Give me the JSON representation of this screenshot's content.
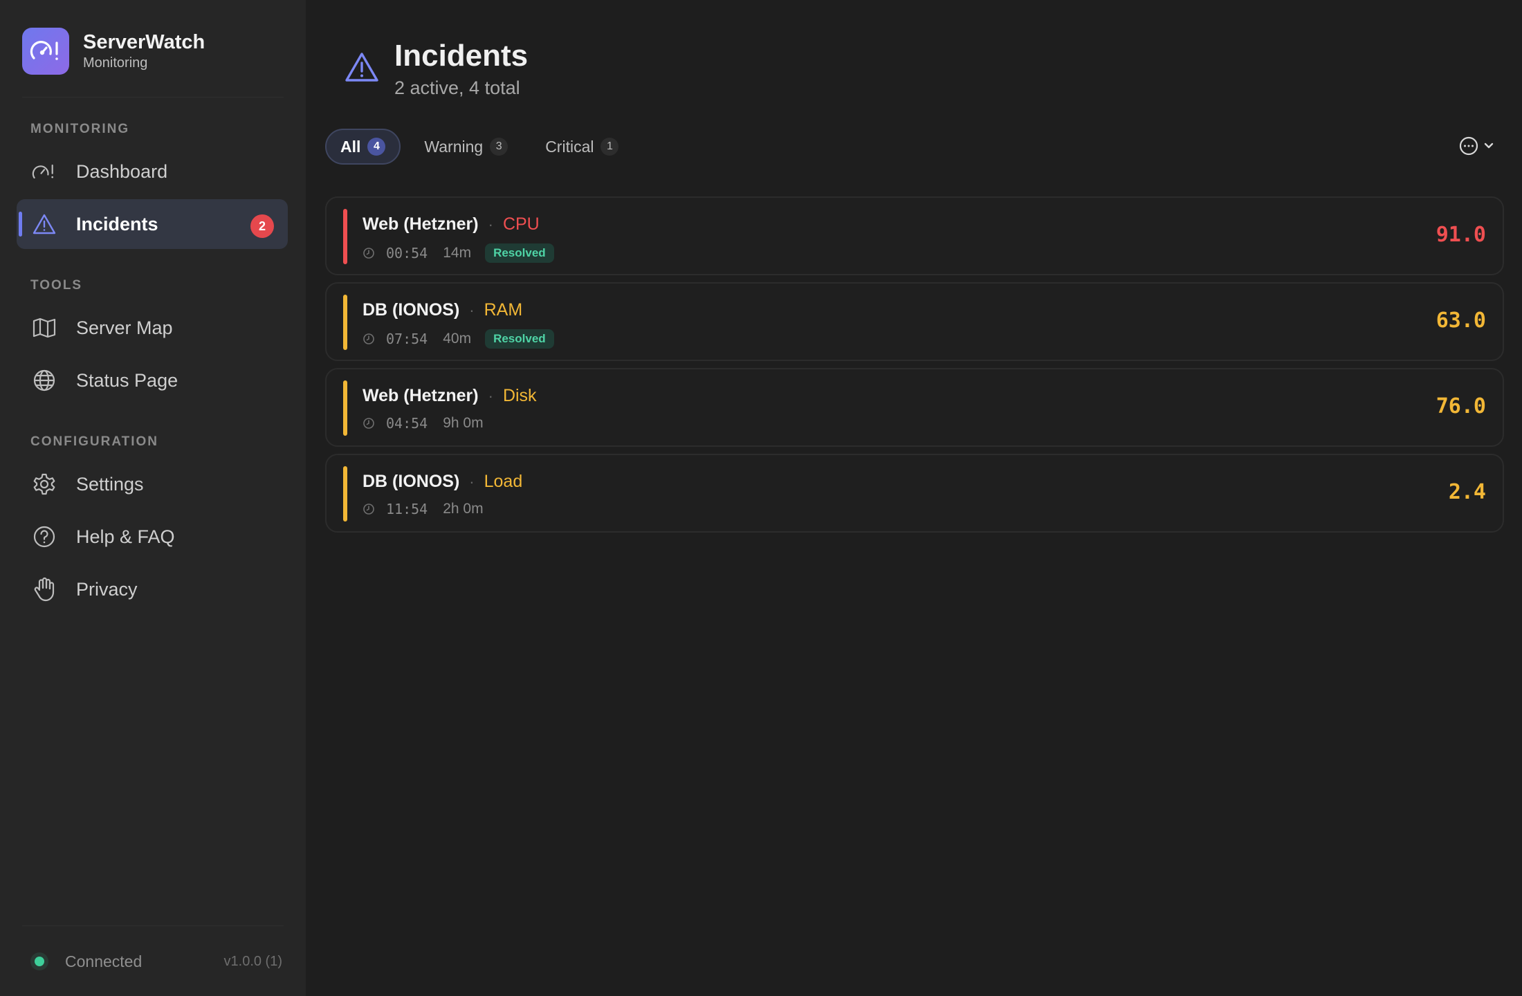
{
  "colors": {
    "critical": "#ef4f51",
    "warning": "#f2b736",
    "accent": "#6f7cf0",
    "resolved": "#4fd4a6"
  },
  "brand": {
    "name": "ServerWatch",
    "subtitle": "Monitoring",
    "icon": "gauge-alert-icon"
  },
  "sidebar": {
    "sections": [
      {
        "label": "MONITORING"
      },
      {
        "label": "TOOLS"
      },
      {
        "label": "CONFIGURATION"
      }
    ],
    "items": [
      {
        "label": "Dashboard",
        "icon": "gauge-alert-icon"
      },
      {
        "label": "Incidents",
        "icon": "warning-triangle-icon",
        "badge": "2",
        "active": true
      },
      {
        "label": "Server Map",
        "icon": "map-icon"
      },
      {
        "label": "Status Page",
        "icon": "globe-icon"
      },
      {
        "label": "Settings",
        "icon": "gear-icon"
      },
      {
        "label": "Help & FAQ",
        "icon": "question-circle-icon"
      },
      {
        "label": "Privacy",
        "icon": "hand-icon"
      }
    ],
    "footer": {
      "status": "Connected",
      "version": "v1.0.0 (1)"
    }
  },
  "header": {
    "title": "Incidents",
    "subtitle": "2 active, 4 total",
    "icon": "warning-triangle-icon"
  },
  "filters": [
    {
      "label": "All",
      "count": "4",
      "active": true
    },
    {
      "label": "Warning",
      "count": "3"
    },
    {
      "label": "Critical",
      "count": "1"
    }
  ],
  "incidents": [
    {
      "server": "Web (Hetzner)",
      "metric": "CPU",
      "severity": "critical",
      "time": "00:54",
      "duration": "14m",
      "status": "Resolved",
      "value": "91.0"
    },
    {
      "server": "DB (IONOS)",
      "metric": "RAM",
      "severity": "warning",
      "time": "07:54",
      "duration": "40m",
      "status": "Resolved",
      "value": "63.0"
    },
    {
      "server": "Web (Hetzner)",
      "metric": "Disk",
      "severity": "warning",
      "time": "04:54",
      "duration": "9h 0m",
      "status": "",
      "value": "76.0"
    },
    {
      "server": "DB (IONOS)",
      "metric": "Load",
      "severity": "warning",
      "time": "11:54",
      "duration": "2h 0m",
      "status": "",
      "value": "2.4"
    }
  ]
}
